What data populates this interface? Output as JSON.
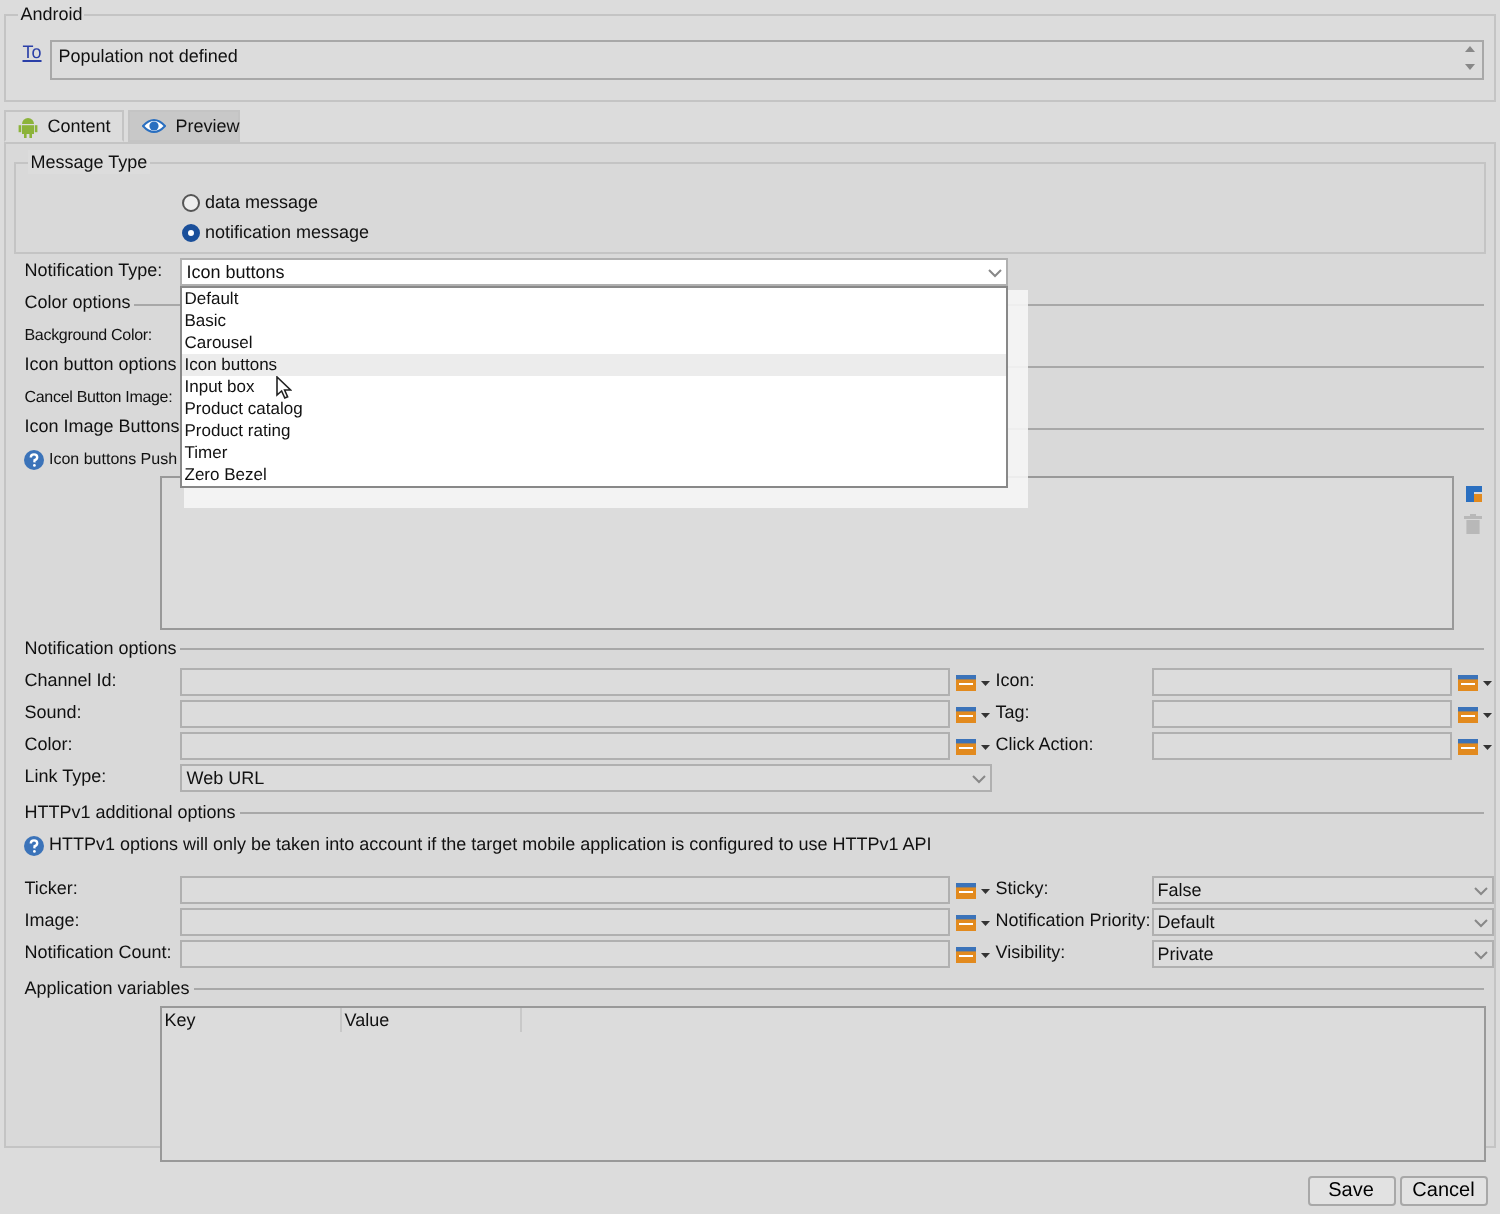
{
  "recipient": {
    "legend": "Android",
    "to_link": "To",
    "value": "Population not defined"
  },
  "tabs": [
    {
      "label": "Content",
      "selected": true
    },
    {
      "label": "Preview",
      "selected": false
    }
  ],
  "message_type": {
    "legend": "Message Type",
    "options": [
      {
        "label": "data message",
        "selected": false
      },
      {
        "label": "notification message",
        "selected": true
      }
    ]
  },
  "notification_type": {
    "label": "Notification Type:",
    "value": "Icon buttons",
    "expanded": true,
    "options": [
      {
        "label": "Default",
        "selected": false
      },
      {
        "label": "Basic",
        "selected": false
      },
      {
        "label": "Carousel",
        "selected": false
      },
      {
        "label": "Icon buttons",
        "selected": true
      },
      {
        "label": "Input box",
        "selected": false
      },
      {
        "label": "Product catalog",
        "selected": false
      },
      {
        "label": "Product rating",
        "selected": false
      },
      {
        "label": "Timer",
        "selected": false
      },
      {
        "label": "Zero Bezel",
        "selected": false
      }
    ]
  },
  "icon_button_rows": [
    {
      "kind": "separator",
      "label": "Color options"
    },
    {
      "kind": "label",
      "label": "Background Color:"
    },
    {
      "kind": "separator",
      "label": "Icon button options"
    },
    {
      "kind": "label",
      "label": "Cancel Button Image:"
    },
    {
      "kind": "separator",
      "label": "Icon Image Buttons"
    },
    {
      "kind": "help",
      "label": "Icon buttons Push"
    }
  ],
  "buttons_table": {
    "delete_disabled": true
  },
  "notification_options": {
    "legend": "Notification options",
    "rows": [
      [
        {
          "label": "Channel Id:",
          "kind": "picker"
        },
        {
          "label": "Icon:",
          "kind": "picker"
        }
      ],
      [
        {
          "label": "Sound:",
          "kind": "picker"
        },
        {
          "label": "Tag:",
          "kind": "picker"
        }
      ],
      [
        {
          "label": "Color:",
          "kind": "picker"
        },
        {
          "label": "Click Action:",
          "kind": "picker"
        }
      ],
      [
        {
          "label": "Link Type:",
          "kind": "select",
          "value": "Web URL"
        }
      ]
    ]
  },
  "httpv1": {
    "legend": "HTTPv1 additional options",
    "note": "HTTPv1 options will only be taken into account if the target mobile application is configured to use HTTPv1 API",
    "rows": [
      [
        {
          "label": "Ticker:",
          "kind": "picker"
        },
        {
          "label": "Sticky:",
          "kind": "select",
          "value": "False"
        }
      ],
      [
        {
          "label": "Image:",
          "kind": "picker"
        },
        {
          "label": "Notification Priority:",
          "kind": "select",
          "value": "Default"
        }
      ],
      [
        {
          "label": "Notification Count:",
          "kind": "picker"
        },
        {
          "label": "Visibility:",
          "kind": "select",
          "value": "Private"
        }
      ]
    ]
  },
  "application_variables": {
    "legend": "Application variables",
    "columns": [
      "Key",
      "Value"
    ]
  },
  "buttons": [
    "Save",
    "Cancel"
  ]
}
